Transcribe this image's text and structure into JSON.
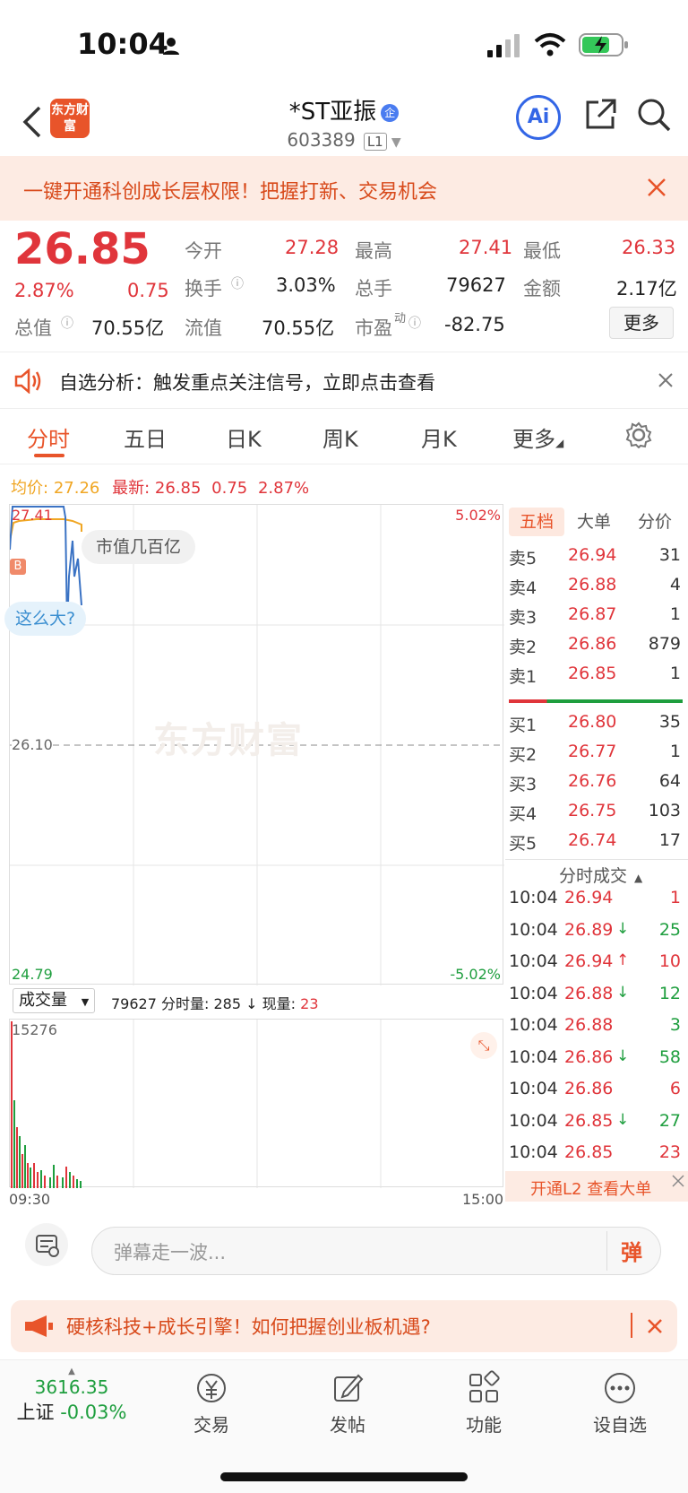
{
  "status_bar": {
    "time": "10:04"
  },
  "header": {
    "brand_logo_text": "东方财富",
    "stock_name": "*ST亚振",
    "stock_code": "603389",
    "level_badge": "L1",
    "ai_label": "Ai"
  },
  "promo": {
    "text": "一键开通科创成长层权限！把握打新、交易机会"
  },
  "quote": {
    "price": "26.85",
    "change_pct": "2.87%",
    "change_amt": "0.75",
    "open_label": "今开",
    "open_value": "27.28",
    "high_label": "最高",
    "high_value": "27.41",
    "low_label": "最低",
    "low_value": "26.33",
    "turnover_label": "换手",
    "turnover_value": "3.03%",
    "volume_label": "总手",
    "volume_value": "79627",
    "amount_label": "金额",
    "amount_value": "2.17亿",
    "mcap_label": "总值",
    "mcap_value": "70.55亿",
    "float_label": "流值",
    "float_value": "70.55亿",
    "pe_label": "市盈",
    "pe_sup": "动",
    "pe_value": "-82.75",
    "more_button": "更多"
  },
  "signal_bar": {
    "text": "自选分析：触发重点关注信号，立即点击查看"
  },
  "tabs": [
    {
      "label": "分时"
    },
    {
      "label": "五日"
    },
    {
      "label": "日K"
    },
    {
      "label": "周K"
    },
    {
      "label": "月K"
    },
    {
      "label": "更多"
    }
  ],
  "chart_header": {
    "avg_label": "均价:",
    "avg_value": "27.26",
    "latest_label": "最新:",
    "latest_value": "26.85",
    "latest_change": "0.75",
    "latest_pct": "2.87%"
  },
  "chart": {
    "top_left": "27.41",
    "mid_left": "26.10",
    "bottom_left": "24.79",
    "top_right": "5.02%",
    "bottom_right": "-5.02%",
    "marker_b": "B",
    "bubble1": "市值几百亿",
    "bubble2": "这么大?",
    "watermark": "东方财富"
  },
  "volume": {
    "selector": "成交量",
    "total": "79627",
    "seg_label": "分时量:",
    "seg_value": "285",
    "seg_arrow": "↓",
    "now_label": "现量:",
    "now_value": "23",
    "max_label": "15276",
    "time_start": "09:30",
    "time_end": "15:00"
  },
  "book_tabs": [
    {
      "label": "五档"
    },
    {
      "label": "大单"
    },
    {
      "label": "分价"
    }
  ],
  "asks": [
    {
      "label": "卖5",
      "price": "26.94",
      "vol": "31"
    },
    {
      "label": "卖4",
      "price": "26.88",
      "vol": "4"
    },
    {
      "label": "卖3",
      "price": "26.87",
      "vol": "1"
    },
    {
      "label": "卖2",
      "price": "26.86",
      "vol": "879"
    },
    {
      "label": "卖1",
      "price": "26.85",
      "vol": "1"
    }
  ],
  "bids": [
    {
      "label": "买1",
      "price": "26.80",
      "vol": "35"
    },
    {
      "label": "买2",
      "price": "26.77",
      "vol": "1"
    },
    {
      "label": "买3",
      "price": "26.76",
      "vol": "64"
    },
    {
      "label": "买4",
      "price": "26.75",
      "vol": "103"
    },
    {
      "label": "买5",
      "price": "26.74",
      "vol": "17"
    }
  ],
  "trades_header": "分时成交",
  "trades": [
    {
      "time": "10:04",
      "price": "26.94",
      "dir": "",
      "vol": "1",
      "color": "red"
    },
    {
      "time": "10:04",
      "price": "26.89",
      "dir": "↓",
      "vol": "25",
      "color": "green"
    },
    {
      "time": "10:04",
      "price": "26.94",
      "dir": "↑",
      "vol": "10",
      "color": "red"
    },
    {
      "time": "10:04",
      "price": "26.88",
      "dir": "↓",
      "vol": "12",
      "color": "green"
    },
    {
      "time": "10:04",
      "price": "26.88",
      "dir": "",
      "vol": "3",
      "color": "green"
    },
    {
      "time": "10:04",
      "price": "26.86",
      "dir": "↓",
      "vol": "58",
      "color": "green"
    },
    {
      "time": "10:04",
      "price": "26.86",
      "dir": "",
      "vol": "6",
      "color": "red"
    },
    {
      "time": "10:04",
      "price": "26.85",
      "dir": "↓",
      "vol": "27",
      "color": "green"
    },
    {
      "time": "10:04",
      "price": "26.85",
      "dir": "",
      "vol": "23",
      "color": "red"
    }
  ],
  "l2_link": "开通L2 查看大单",
  "danmu": {
    "placeholder": "弹幕走一波...",
    "button": "弹"
  },
  "banner": {
    "text": "硬核科技+成长引擎！如何把握创业板机遇?"
  },
  "nav": {
    "index_value": "3616.35",
    "index_name": "上证",
    "index_change": "-0.03%",
    "items": [
      {
        "label": "交易"
      },
      {
        "label": "发帖"
      },
      {
        "label": "功能"
      },
      {
        "label": "设自选"
      }
    ]
  },
  "colors": {
    "up": "#e0353b",
    "down": "#1e9e3e",
    "accent": "#e8542a",
    "avg_line": "#f0a623"
  }
}
